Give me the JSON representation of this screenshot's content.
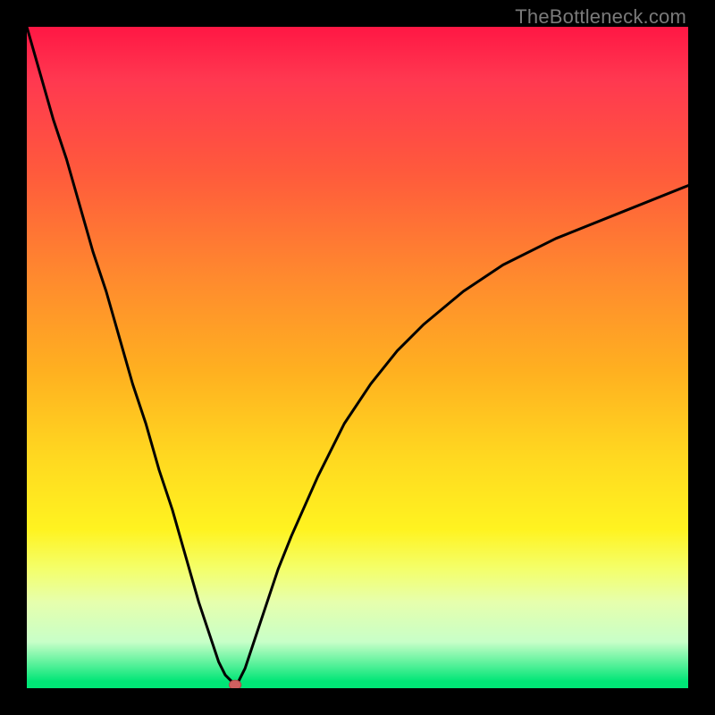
{
  "watermark": "TheBottleneck.com",
  "chart_data": {
    "type": "line",
    "title": "",
    "xlabel": "",
    "ylabel": "",
    "xlim": [
      0,
      100
    ],
    "ylim": [
      0,
      100
    ],
    "background_gradient_stops": [
      {
        "pos": 0,
        "color": "#ff1744"
      },
      {
        "pos": 8,
        "color": "#ff3850"
      },
      {
        "pos": 22,
        "color": "#ff5a3c"
      },
      {
        "pos": 38,
        "color": "#ff8a2e"
      },
      {
        "pos": 52,
        "color": "#ffb020"
      },
      {
        "pos": 65,
        "color": "#ffd820"
      },
      {
        "pos": 76,
        "color": "#fff320"
      },
      {
        "pos": 82,
        "color": "#f4ff6b"
      },
      {
        "pos": 87,
        "color": "#e6ffad"
      },
      {
        "pos": 93,
        "color": "#c8ffc8"
      },
      {
        "pos": 99,
        "color": "#00e676"
      },
      {
        "pos": 100,
        "color": "#00e676"
      }
    ],
    "series": [
      {
        "name": "bottleneck-curve",
        "color": "#000000",
        "x": [
          0,
          2,
          4,
          6,
          8,
          10,
          12,
          14,
          16,
          18,
          20,
          22,
          24,
          26,
          28,
          29,
          30,
          31,
          31.5,
          32,
          33,
          34,
          36,
          38,
          40,
          44,
          48,
          52,
          56,
          60,
          66,
          72,
          80,
          90,
          100
        ],
        "y": [
          100,
          93,
          86,
          80,
          73,
          66,
          60,
          53,
          46,
          40,
          33,
          27,
          20,
          13,
          7,
          4,
          2,
          1,
          0.5,
          1,
          3,
          6,
          12,
          18,
          23,
          32,
          40,
          46,
          51,
          55,
          60,
          64,
          68,
          72,
          76
        ]
      }
    ],
    "marker": {
      "name": "optimal-point",
      "x": 31.5,
      "y": 0.5,
      "color": "#d06060",
      "rx": 0.9,
      "ry": 0.7
    }
  }
}
